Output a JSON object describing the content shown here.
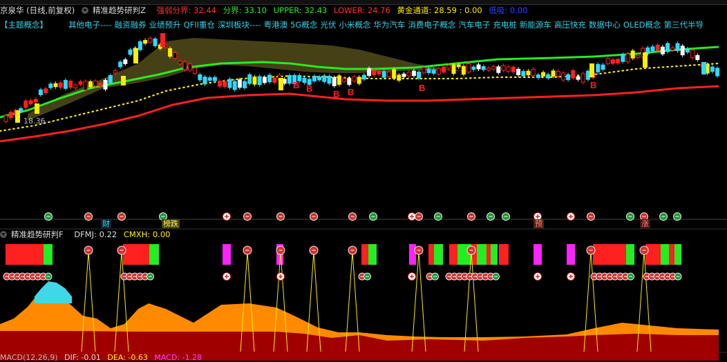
{
  "header": {
    "stock_name": "京泉华 (日线,前复权)",
    "indicator_name": "精准趋势研判Z",
    "strong_weak": "强弱分界: 32.44",
    "divide": "分界: 33.10",
    "upper": "UPPER: 32.43",
    "lower": "LOWER: 24.76",
    "gold_channel": "黄金通道: 28.59 : 0.00",
    "low_absorb": "低吸: 0.00"
  },
  "concepts": [
    "【主题概念】",
    "其他电子----",
    "融资融券",
    "业绩预升",
    "QFII重仓",
    "深圳板块----",
    "粤港澳",
    "5G概念",
    "光伏",
    "小米概念",
    "华为汽车",
    "消费电子概念",
    "汽车电子",
    "充电桩",
    "新能源车",
    "高压快充",
    "数据中心",
    "OLED概念",
    "第三代半导"
  ],
  "price_label": "18.36",
  "markers": {
    "b_labels": [
      "B",
      "B",
      "B",
      "B",
      "B",
      "B"
    ],
    "bottom_tags": [
      "财",
      "榜跌",
      "预",
      "涨"
    ]
  },
  "sub_header": {
    "indicator": "精准趋势研判F",
    "dfmj": "DFMJ: 0.22",
    "cmxh": "CMXH: 0.00"
  },
  "macd_header": {
    "title": "MACD(12,26,9)",
    "dif": "DIF: -0.01",
    "dea": "DEA: -0.63",
    "macd": "MACD: -1.28"
  },
  "colors": {
    "up": "#ff2020",
    "down": "#30d8ff",
    "yellow": "#ffee00",
    "green": "#22ee22",
    "magenta": "#ff22ff",
    "orange": "#ff8a00",
    "darkred": "#a00000",
    "cloud": "#4a4318"
  },
  "icons": [
    "collapse-circle-icon",
    "sell-marker-icon",
    "buy-marker-icon",
    "plus-marker-icon"
  ]
}
